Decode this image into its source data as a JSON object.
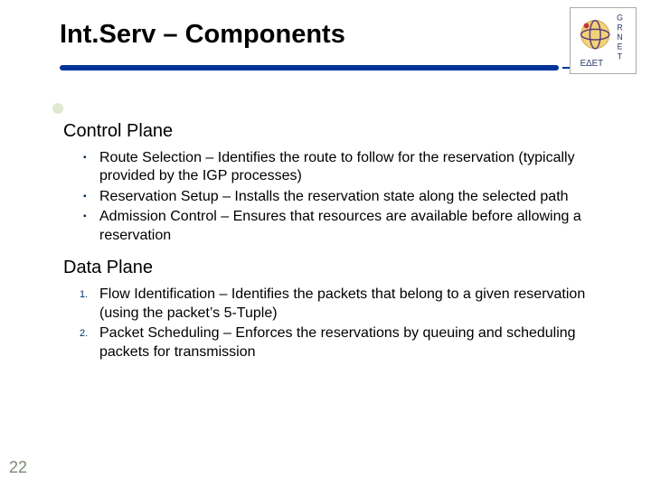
{
  "title": "Int.Serv – Components",
  "logo": {
    "name": "grnet-edet-logo",
    "top": "GRNET",
    "bottom": "ΕΔΕΤ"
  },
  "sections": {
    "control": {
      "heading": "Control Plane",
      "items": [
        "Route Selection – Identifies the route to follow for the reservation (typically provided by the IGP processes)",
        "Reservation Setup – Installs the reservation state along the selected path",
        "Admission Control – Ensures that resources are available before allowing a reservation"
      ]
    },
    "data": {
      "heading": "Data Plane",
      "items": [
        "Flow Identification – Identifies the packets that belong to a given reservation (using the packet’s 5-Tuple)",
        "Packet Scheduling – Enforces the reservations by queuing and scheduling packets for transmission"
      ],
      "numbers": [
        "1.",
        "2."
      ]
    }
  },
  "slide_number": "22"
}
